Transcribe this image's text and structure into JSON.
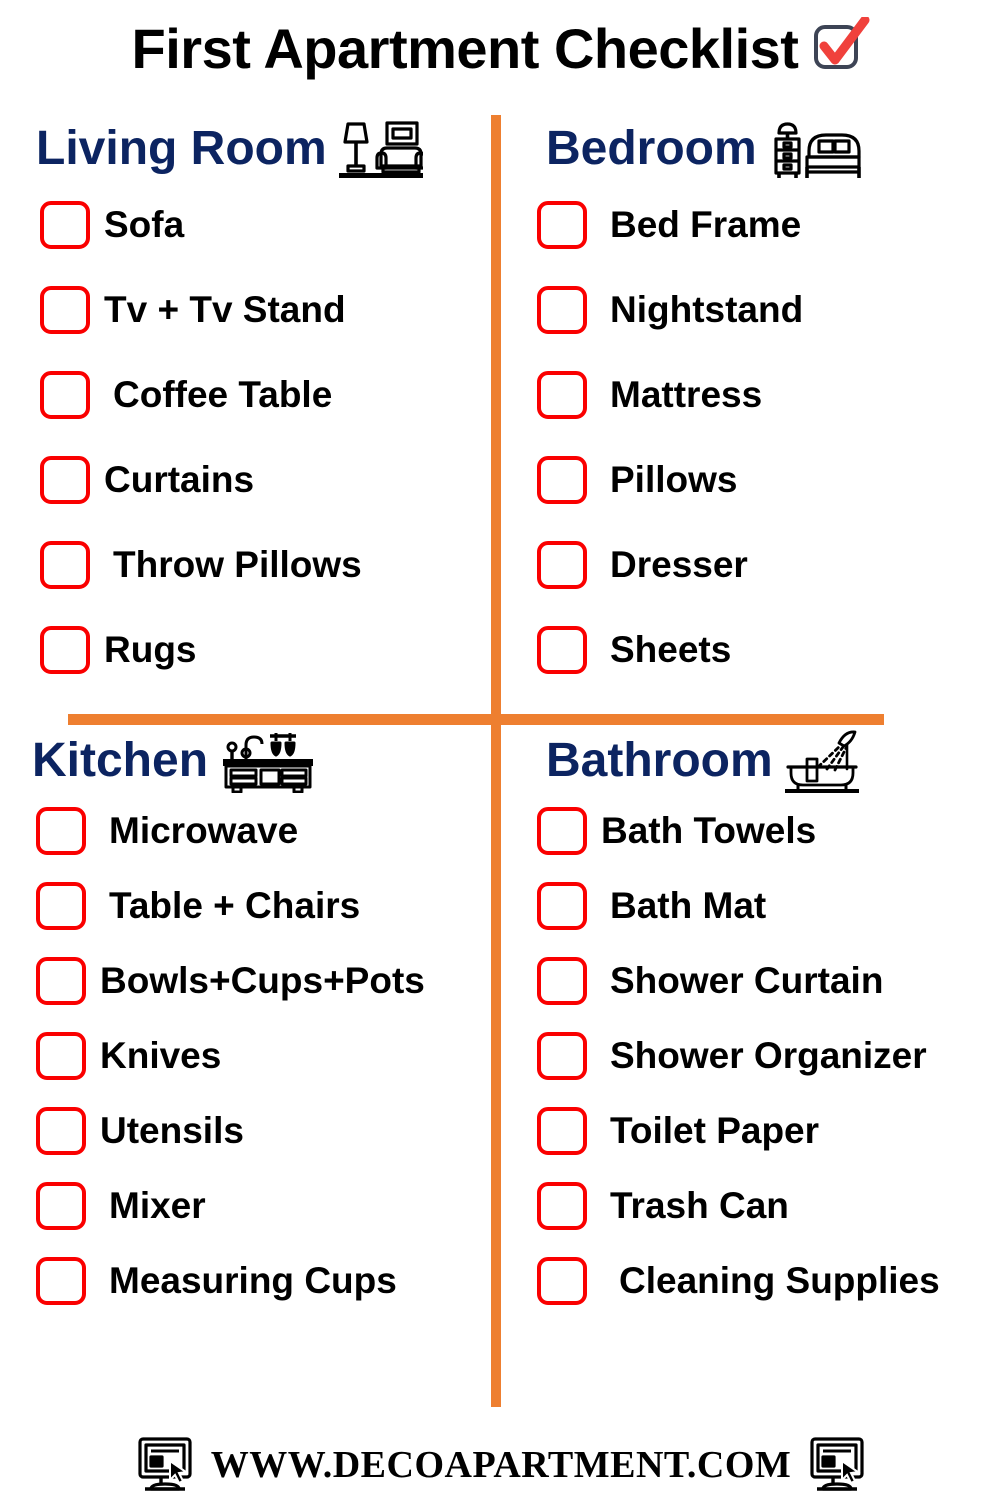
{
  "header": {
    "title": "First Apartment Checklist",
    "icon": "checked-checkbox-icon"
  },
  "theme": {
    "divider_color": "#EE7F30",
    "heading_color": "#0C2461",
    "checkbox_color": "#FA0000",
    "text_color": "#000000",
    "background": "#FFFFFF",
    "check_mark_color": "#F0413C"
  },
  "sections": [
    {
      "id": "living-room",
      "title": "Living Room",
      "icon": "living-room-icon",
      "items": [
        {
          "label": "Sofa",
          "checked": false
        },
        {
          "label": "Tv + Tv Stand",
          "checked": false
        },
        {
          "label": "Coffee Table",
          "checked": false
        },
        {
          "label": "Curtains",
          "checked": false
        },
        {
          "label": "Throw Pillows",
          "checked": false
        },
        {
          "label": "Rugs",
          "checked": false
        }
      ]
    },
    {
      "id": "bedroom",
      "title": "Bedroom",
      "icon": "bedroom-icon",
      "items": [
        {
          "label": "Bed Frame",
          "checked": false
        },
        {
          "label": "Nightstand",
          "checked": false
        },
        {
          "label": "Mattress",
          "checked": false
        },
        {
          "label": "Pillows",
          "checked": false
        },
        {
          "label": "Dresser",
          "checked": false
        },
        {
          "label": "Sheets",
          "checked": false
        }
      ]
    },
    {
      "id": "kitchen",
      "title": "Kitchen",
      "icon": "kitchen-counter-icon",
      "items": [
        {
          "label": "Microwave",
          "checked": false
        },
        {
          "label": "Table + Chairs",
          "checked": false
        },
        {
          "label": "Bowls+Cups+Pots",
          "checked": false
        },
        {
          "label": "Knives",
          "checked": false
        },
        {
          "label": "Utensils",
          "checked": false
        },
        {
          "label": "Mixer",
          "checked": false
        },
        {
          "label": "Measuring Cups",
          "checked": false
        }
      ]
    },
    {
      "id": "bathroom",
      "title": "Bathroom",
      "icon": "bathtub-shower-icon",
      "items": [
        {
          "label": "Bath Towels",
          "checked": false
        },
        {
          "label": "Bath Mat",
          "checked": false
        },
        {
          "label": "Shower Curtain",
          "checked": false
        },
        {
          "label": "Shower Organizer",
          "checked": false
        },
        {
          "label": "Toilet Paper",
          "checked": false
        },
        {
          "label": "Trash Can",
          "checked": false
        },
        {
          "label": "Cleaning Supplies",
          "checked": false
        }
      ]
    }
  ],
  "footer": {
    "url": "WWW.DECOAPARTMENT.COM",
    "left_icon": "monitor-icon",
    "right_icon": "monitor-icon"
  }
}
